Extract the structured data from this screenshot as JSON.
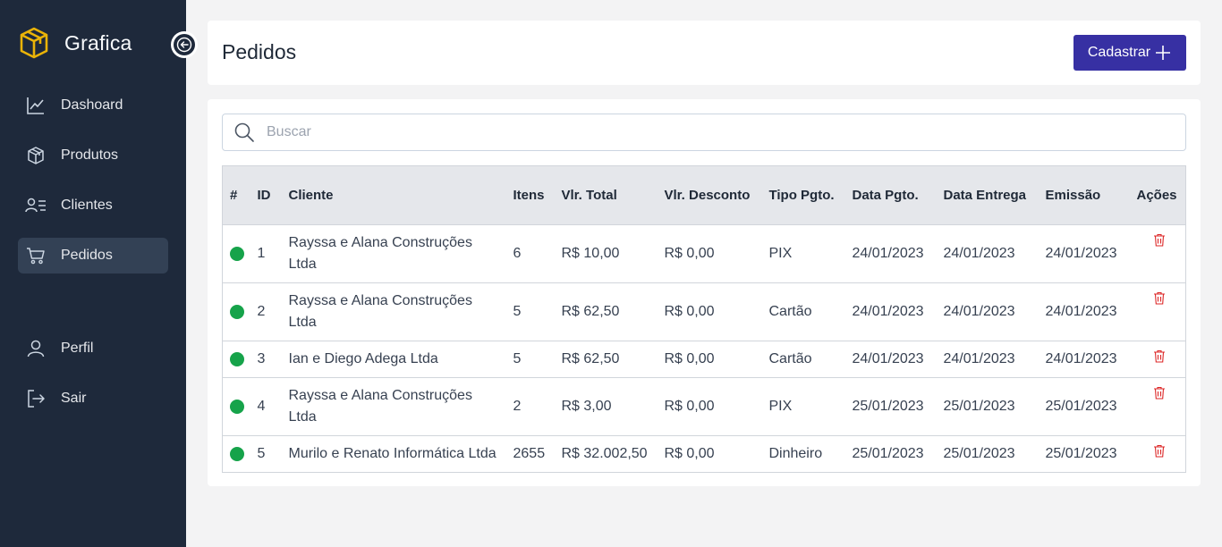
{
  "app": {
    "name": "Grafica"
  },
  "colors": {
    "sidebar": "#1e293b",
    "accent": "#3730a3",
    "logo": "#eab308",
    "status_ok": "#16a34a",
    "delete": "#dc2626"
  },
  "sidebar": {
    "items": [
      {
        "label": "Dashoard",
        "icon": "chart-line-icon"
      },
      {
        "label": "Produtos",
        "icon": "box-icon"
      },
      {
        "label": "Clientes",
        "icon": "users-list-icon"
      },
      {
        "label": "Pedidos",
        "icon": "cart-icon",
        "active": true
      },
      {
        "label": "Perfil",
        "icon": "user-icon"
      },
      {
        "label": "Sair",
        "icon": "logout-icon"
      }
    ]
  },
  "header": {
    "title": "Pedidos",
    "button_label": "Cadastrar"
  },
  "search": {
    "placeholder": "Buscar",
    "value": ""
  },
  "table": {
    "headers": [
      "#",
      "ID",
      "Cliente",
      "Itens",
      "Vlr. Total",
      "Vlr. Desconto",
      "Tipo Pgto.",
      "Data Pgto.",
      "Data Entrega",
      "Emissão",
      "Ações"
    ],
    "rows": [
      {
        "id": "1",
        "cliente": "Rayssa e Alana Construções Ltda",
        "itens": "6",
        "total": "R$ 10,00",
        "desconto": "R$ 0,00",
        "tipo": "PIX",
        "data_pgto": "24/01/2023",
        "data_entrega": "24/01/2023",
        "emissao": "24/01/2023"
      },
      {
        "id": "2",
        "cliente": "Rayssa e Alana Construções Ltda",
        "itens": "5",
        "total": "R$ 62,50",
        "desconto": "R$ 0,00",
        "tipo": "Cartão",
        "data_pgto": "24/01/2023",
        "data_entrega": "24/01/2023",
        "emissao": "24/01/2023"
      },
      {
        "id": "3",
        "cliente": "Ian e Diego Adega Ltda",
        "itens": "5",
        "total": "R$ 62,50",
        "desconto": "R$ 0,00",
        "tipo": "Cartão",
        "data_pgto": "24/01/2023",
        "data_entrega": "24/01/2023",
        "emissao": "24/01/2023"
      },
      {
        "id": "4",
        "cliente": "Rayssa e Alana Construções Ltda",
        "itens": "2",
        "total": "R$ 3,00",
        "desconto": "R$ 0,00",
        "tipo": "PIX",
        "data_pgto": "25/01/2023",
        "data_entrega": "25/01/2023",
        "emissao": "25/01/2023"
      },
      {
        "id": "5",
        "cliente": "Murilo e Renato Informática Ltda",
        "itens": "2655",
        "total": "R$ 32.002,50",
        "desconto": "R$ 0,00",
        "tipo": "Dinheiro",
        "data_pgto": "25/01/2023",
        "data_entrega": "25/01/2023",
        "emissao": "25/01/2023"
      }
    ]
  }
}
